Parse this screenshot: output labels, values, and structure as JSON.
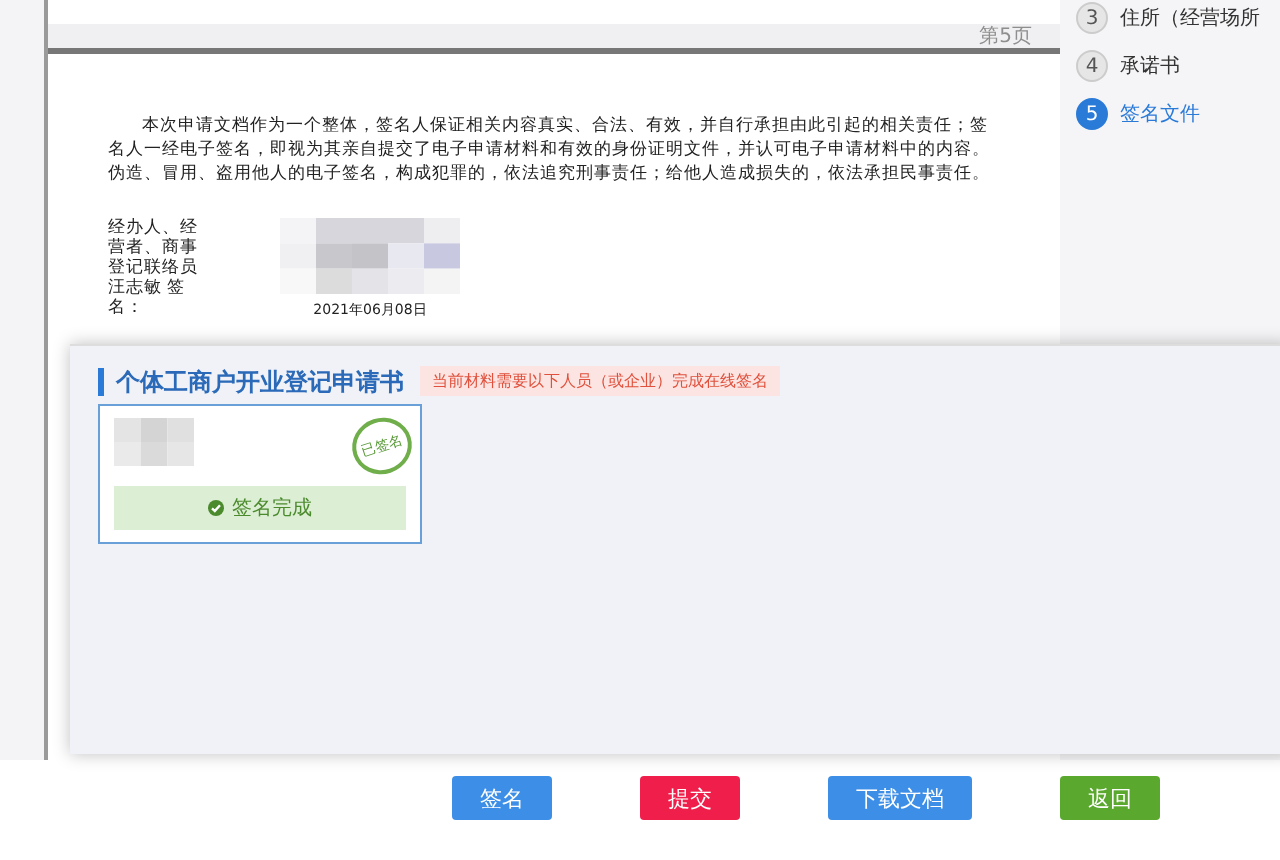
{
  "document": {
    "page_label": "第5页",
    "paragraph": "本次申请文档作为一个整体，签名人保证相关内容真实、合法、有效，并自行承担由此引起的相关责任；签名人一经电子签名，即视为其亲自提交了电子申请材料和有效的身份证明文件，并认可电子申请材料中的内容。伪造、冒用、盗用他人的电子签名，构成犯罪的，依法追究刑事责任；给他人造成损失的，依法承担民事责任。",
    "signer_label": "经办人、经营者、商事登记联络员汪志敏 签名：",
    "date": "2021年06月08日"
  },
  "steps": [
    {
      "number": "3",
      "label": "住所（经营场所",
      "selected": false
    },
    {
      "number": "4",
      "label": "承诺书",
      "selected": false
    },
    {
      "number": "5",
      "label": "签名文件",
      "selected": true
    }
  ],
  "sign_panel": {
    "title": "个体工商户开业登记申请书",
    "notice": "当前材料需要以下人员（或企业）完成在线签名",
    "signers": [
      {
        "stamp": "已签名",
        "status": "签名完成",
        "signed": true
      }
    ]
  },
  "buttons": [
    {
      "label": "签名",
      "kind": "primary"
    },
    {
      "label": "提交",
      "kind": "danger"
    },
    {
      "label": "下载文档",
      "kind": "primary"
    },
    {
      "label": "返回",
      "kind": "success"
    }
  ]
}
